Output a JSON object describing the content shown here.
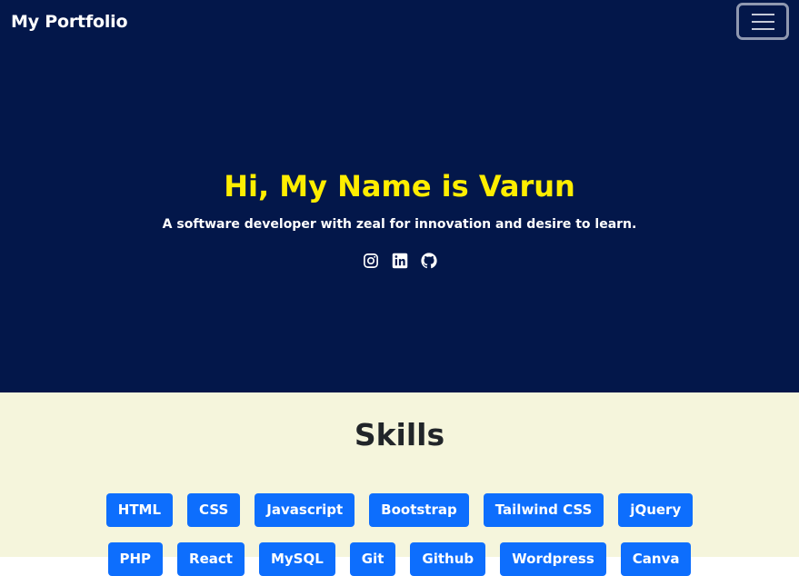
{
  "navbar": {
    "brand": "My Portfolio",
    "toggler_icon": "hamburger-icon"
  },
  "hero": {
    "title": "Hi, My Name is Varun",
    "subtitle": "A software developer with zeal for innovation and desire to learn.",
    "socials": [
      "instagram-icon",
      "linkedin-icon",
      "github-icon"
    ]
  },
  "skills": {
    "title": "Skills",
    "row1": [
      "HTML",
      "CSS",
      "Javascript",
      "Bootstrap",
      "Tailwind CSS",
      "jQuery"
    ],
    "row2": [
      "PHP",
      "React",
      "MySQL",
      "Git",
      "Github",
      "Wordpress",
      "Canva"
    ]
  },
  "colors": {
    "navy": "#03174a",
    "yellow": "#ffee00",
    "cream": "#f5f5dc",
    "blue": "#0d6efd"
  }
}
